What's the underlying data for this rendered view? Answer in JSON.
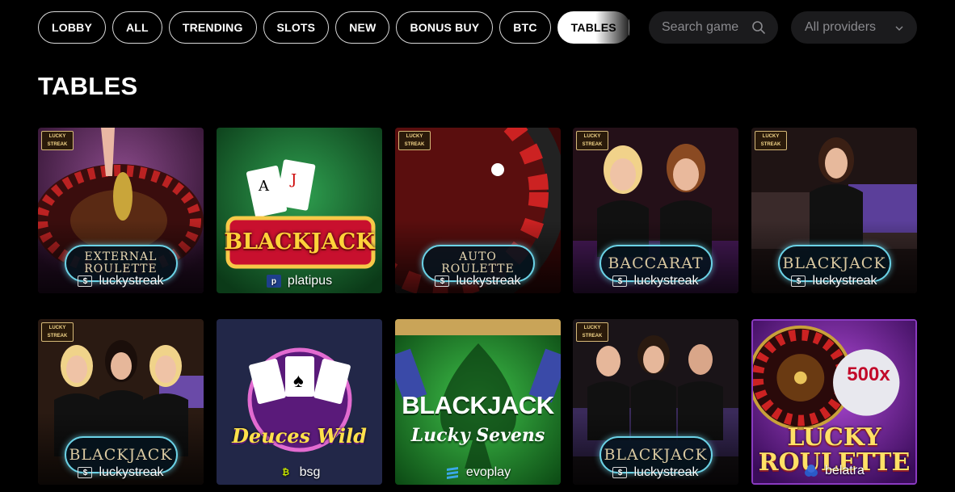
{
  "categories": [
    {
      "label": "LOBBY",
      "active": false
    },
    {
      "label": "ALL",
      "active": false
    },
    {
      "label": "TRENDING",
      "active": false
    },
    {
      "label": "SLOTS",
      "active": false
    },
    {
      "label": "NEW",
      "active": false
    },
    {
      "label": "BONUS BUY",
      "active": false
    },
    {
      "label": "BTC",
      "active": false
    },
    {
      "label": "TABLES",
      "active": true
    }
  ],
  "search": {
    "placeholder": "Search game",
    "icon": "search-icon"
  },
  "providers_filter": {
    "selected": "All providers",
    "icon": "chevron-down-icon"
  },
  "section": {
    "title": "TABLES"
  },
  "games": [
    {
      "title": "EXTERNAL ROULETTE",
      "provider": "luckystreak",
      "badge": "LUCKY STREAK"
    },
    {
      "title": "BLACKJACK",
      "provider": "platipus",
      "badge": ""
    },
    {
      "title": "AUTO ROULETTE",
      "provider": "luckystreak",
      "badge": "LUCKY STREAK"
    },
    {
      "title": "BACCARAT",
      "provider": "luckystreak",
      "badge": "LUCKY STREAK"
    },
    {
      "title": "BLACKJACK",
      "provider": "luckystreak",
      "badge": "LUCKY STREAK"
    },
    {
      "title": "BLACKJACK",
      "provider": "luckystreak",
      "badge": "LUCKY STREAK"
    },
    {
      "title": "Deuces Wild",
      "provider": "bsg",
      "badge": ""
    },
    {
      "title": "BLACKJACK",
      "subtitle": "Lucky Sevens",
      "provider": "evoplay",
      "badge": ""
    },
    {
      "title": "BLACKJACK",
      "provider": "luckystreak",
      "badge": "LUCKY STREAK"
    },
    {
      "title": "LUCKY ROULETTE",
      "multiplier": "500x",
      "provider": "belatra",
      "badge": ""
    }
  ],
  "colors": {
    "background": "#000000",
    "chip_active_bg": "#ffffff",
    "input_bg": "#1b1b1d",
    "placeholder": "#8a8a8e",
    "accent_cyan": "#6bd2e6"
  }
}
